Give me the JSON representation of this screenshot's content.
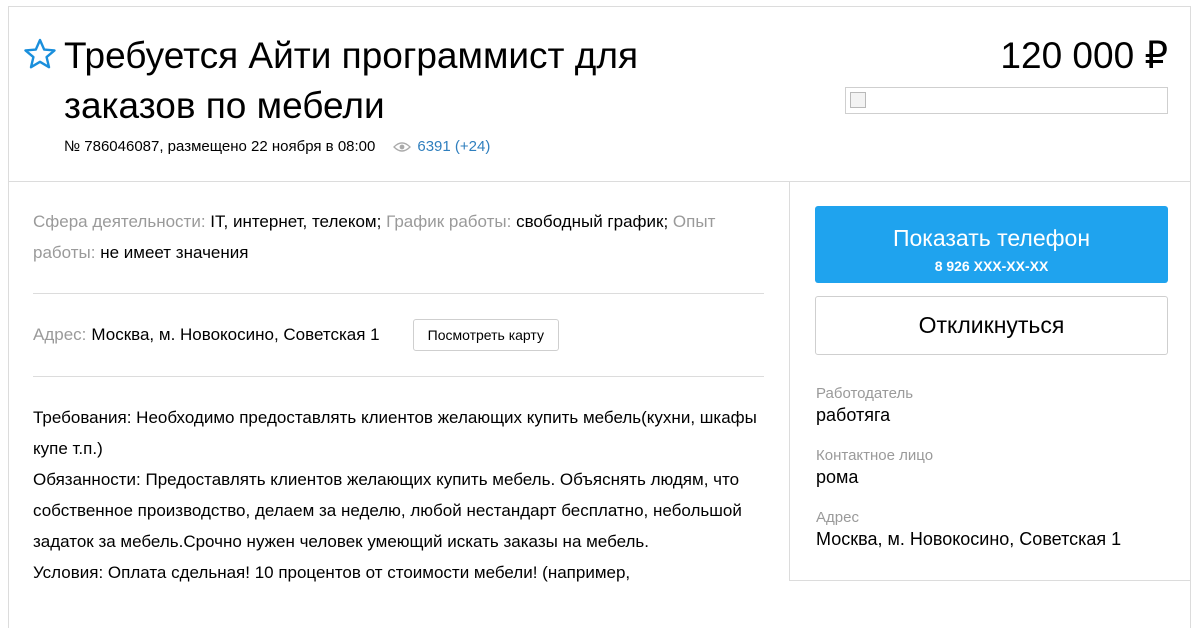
{
  "listing": {
    "title": "Требуется Айти программист для заказов по мебели",
    "meta_text": "№ 786046087, размещено 22 ноября в 08:00",
    "views": "6391 (+24)",
    "price": "120 000 ₽"
  },
  "params": {
    "sphere_label": "Сфера деятельности:",
    "sphere_value": "IT, интернет, телеком;",
    "schedule_label": "График работы:",
    "schedule_value": "свободный график;",
    "experience_label": "Опыт работы:",
    "experience_value": "не имеет значения"
  },
  "address": {
    "label": "Адрес:",
    "value": "Москва, м. Новокосино, Советская 1",
    "map_button": "Посмотреть карту"
  },
  "description": [
    "Требования: Необходимо предоставлять клиентов желающих купить мебель(кухни, шкафы купе т.п.)",
    "Обязанности: Предоставлять клиентов желающих купить мебель. Объяснять людям, что собственное производство, делаем за неделю, любой нестандарт бесплатно, небольшой задаток за мебель.Срочно нужен человек умеющий искать заказы на мебель.",
    "Условия: Оплата сдельная! 10 процентов от стоимости мебели! (например,"
  ],
  "sidebar": {
    "show_phone": "Показать телефон",
    "phone_masked": "8 926 XXX-XX-XX",
    "respond": "Откликнуться",
    "employer_label": "Работодатель",
    "employer_value": "работяга",
    "contact_label": "Контактное лицо",
    "contact_value": "рома",
    "address_label": "Адрес",
    "address_value": "Москва, м. Новокосино, Советская 1"
  },
  "colors": {
    "accent": "#1fa3ee",
    "link": "#2f7fbe",
    "muted": "#9a9a9a",
    "star": "#1a8fdc"
  }
}
